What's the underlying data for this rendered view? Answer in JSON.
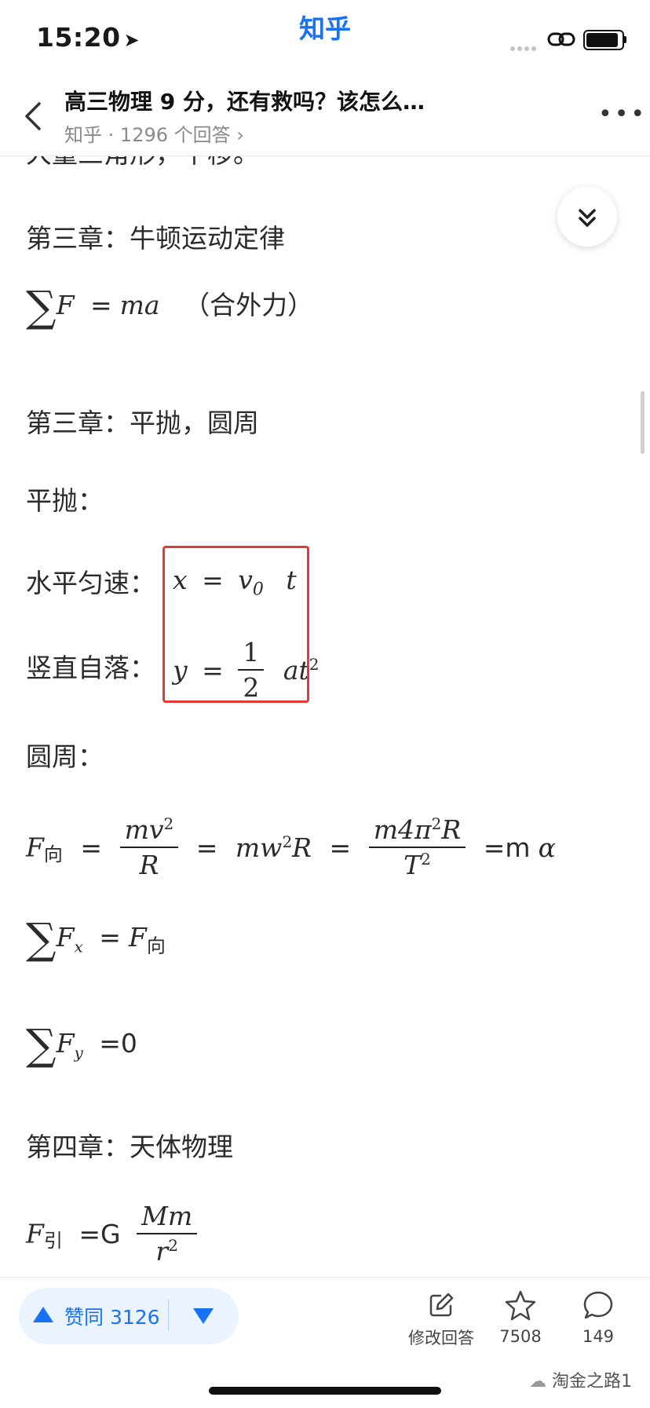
{
  "status": {
    "time": "15:20",
    "app_name": "知乎"
  },
  "header": {
    "title": "高三物理 9 分，还有救吗？该怎么…",
    "source": "知乎",
    "separator": "·",
    "answers": "1296 个回答"
  },
  "content": {
    "partial_top": "大量三角形，平移。",
    "ch3a": "第三章：牛顿运动定律",
    "newton_rhs": "ma",
    "newton_note": "（合外力）",
    "ch3b": "第三章：平抛，圆周",
    "pingpao": "平抛：",
    "horizontal_label": "水平匀速：",
    "vertical_label": "竖直自落：",
    "circle": "圆周：",
    "eq_xF_rhs": "F",
    "eq_sumFy_rhs": "=0",
    "ch4": "第四章：天体物理",
    "grav_eq": "=G",
    "sub_xiang": "向",
    "sub_yin": "引",
    "eq_m_alpha": "=m"
  },
  "bottom": {
    "vote_label": "赞同 3126",
    "edit_label": "修改回答",
    "star_count": "7508",
    "comment_count": "149",
    "watermark": "淘金之路1"
  },
  "colors": {
    "brand": "#1772f6",
    "highlight_box": "#e53935"
  }
}
